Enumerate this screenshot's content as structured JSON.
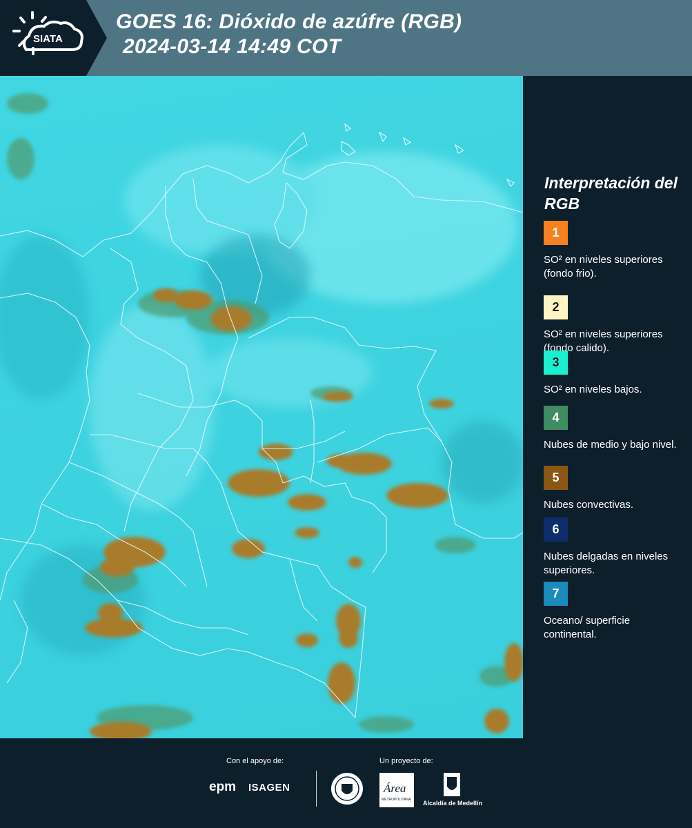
{
  "header": {
    "logo_text": "SIATA",
    "title_line1": "GOES 16: Dióxido de azúfre (RGB)",
    "title_line2": "2024-03-14 14:49 COT"
  },
  "legend": {
    "title": "Interpretación del RGB",
    "items": [
      {
        "num": "1",
        "label": "SO² en niveles superiores (fondo frio).",
        "color": "#f5821f",
        "text_color": "#ffffff"
      },
      {
        "num": "2",
        "label": "SO² en niveles superiores (fondo calido).",
        "color": "#fdf6c3",
        "text_color": "#1a1a1a"
      },
      {
        "num": "3",
        "label": "SO² en niveles bajos.",
        "color": "#19f0cf",
        "text_color": "#1a1a1a"
      },
      {
        "num": "4",
        "label": "Nubes de medio y bajo nivel.",
        "color": "#3f8b62",
        "text_color": "#ffffff"
      },
      {
        "num": "5",
        "label": "Nubes convectivas.",
        "color": "#8c5712",
        "text_color": "#ffffff"
      },
      {
        "num": "6",
        "label": "Nubes delgadas en niveles superiores.",
        "color": "#0d2d6d",
        "text_color": "#ffffff"
      },
      {
        "num": "7",
        "label": "Oceano/ superficie continental.",
        "color": "#1a8bbb",
        "text_color": "#ffffff"
      }
    ]
  },
  "footer": {
    "support_label": "Con el apoyo de:",
    "project_label": "Un proyecto de:",
    "sponsor1": "epm",
    "sponsor2": "ISAGEN",
    "partner_area": "Área",
    "partner_area_sub": "METROPOLITANA",
    "partner_alcaldia": "Alcaldía de Medellín"
  },
  "colors": {
    "header_bg": "#4f7585",
    "dark_bg": "#0e1f2c",
    "map_base": "#3ed3e0",
    "convective_cloud": "#a87c2c"
  }
}
